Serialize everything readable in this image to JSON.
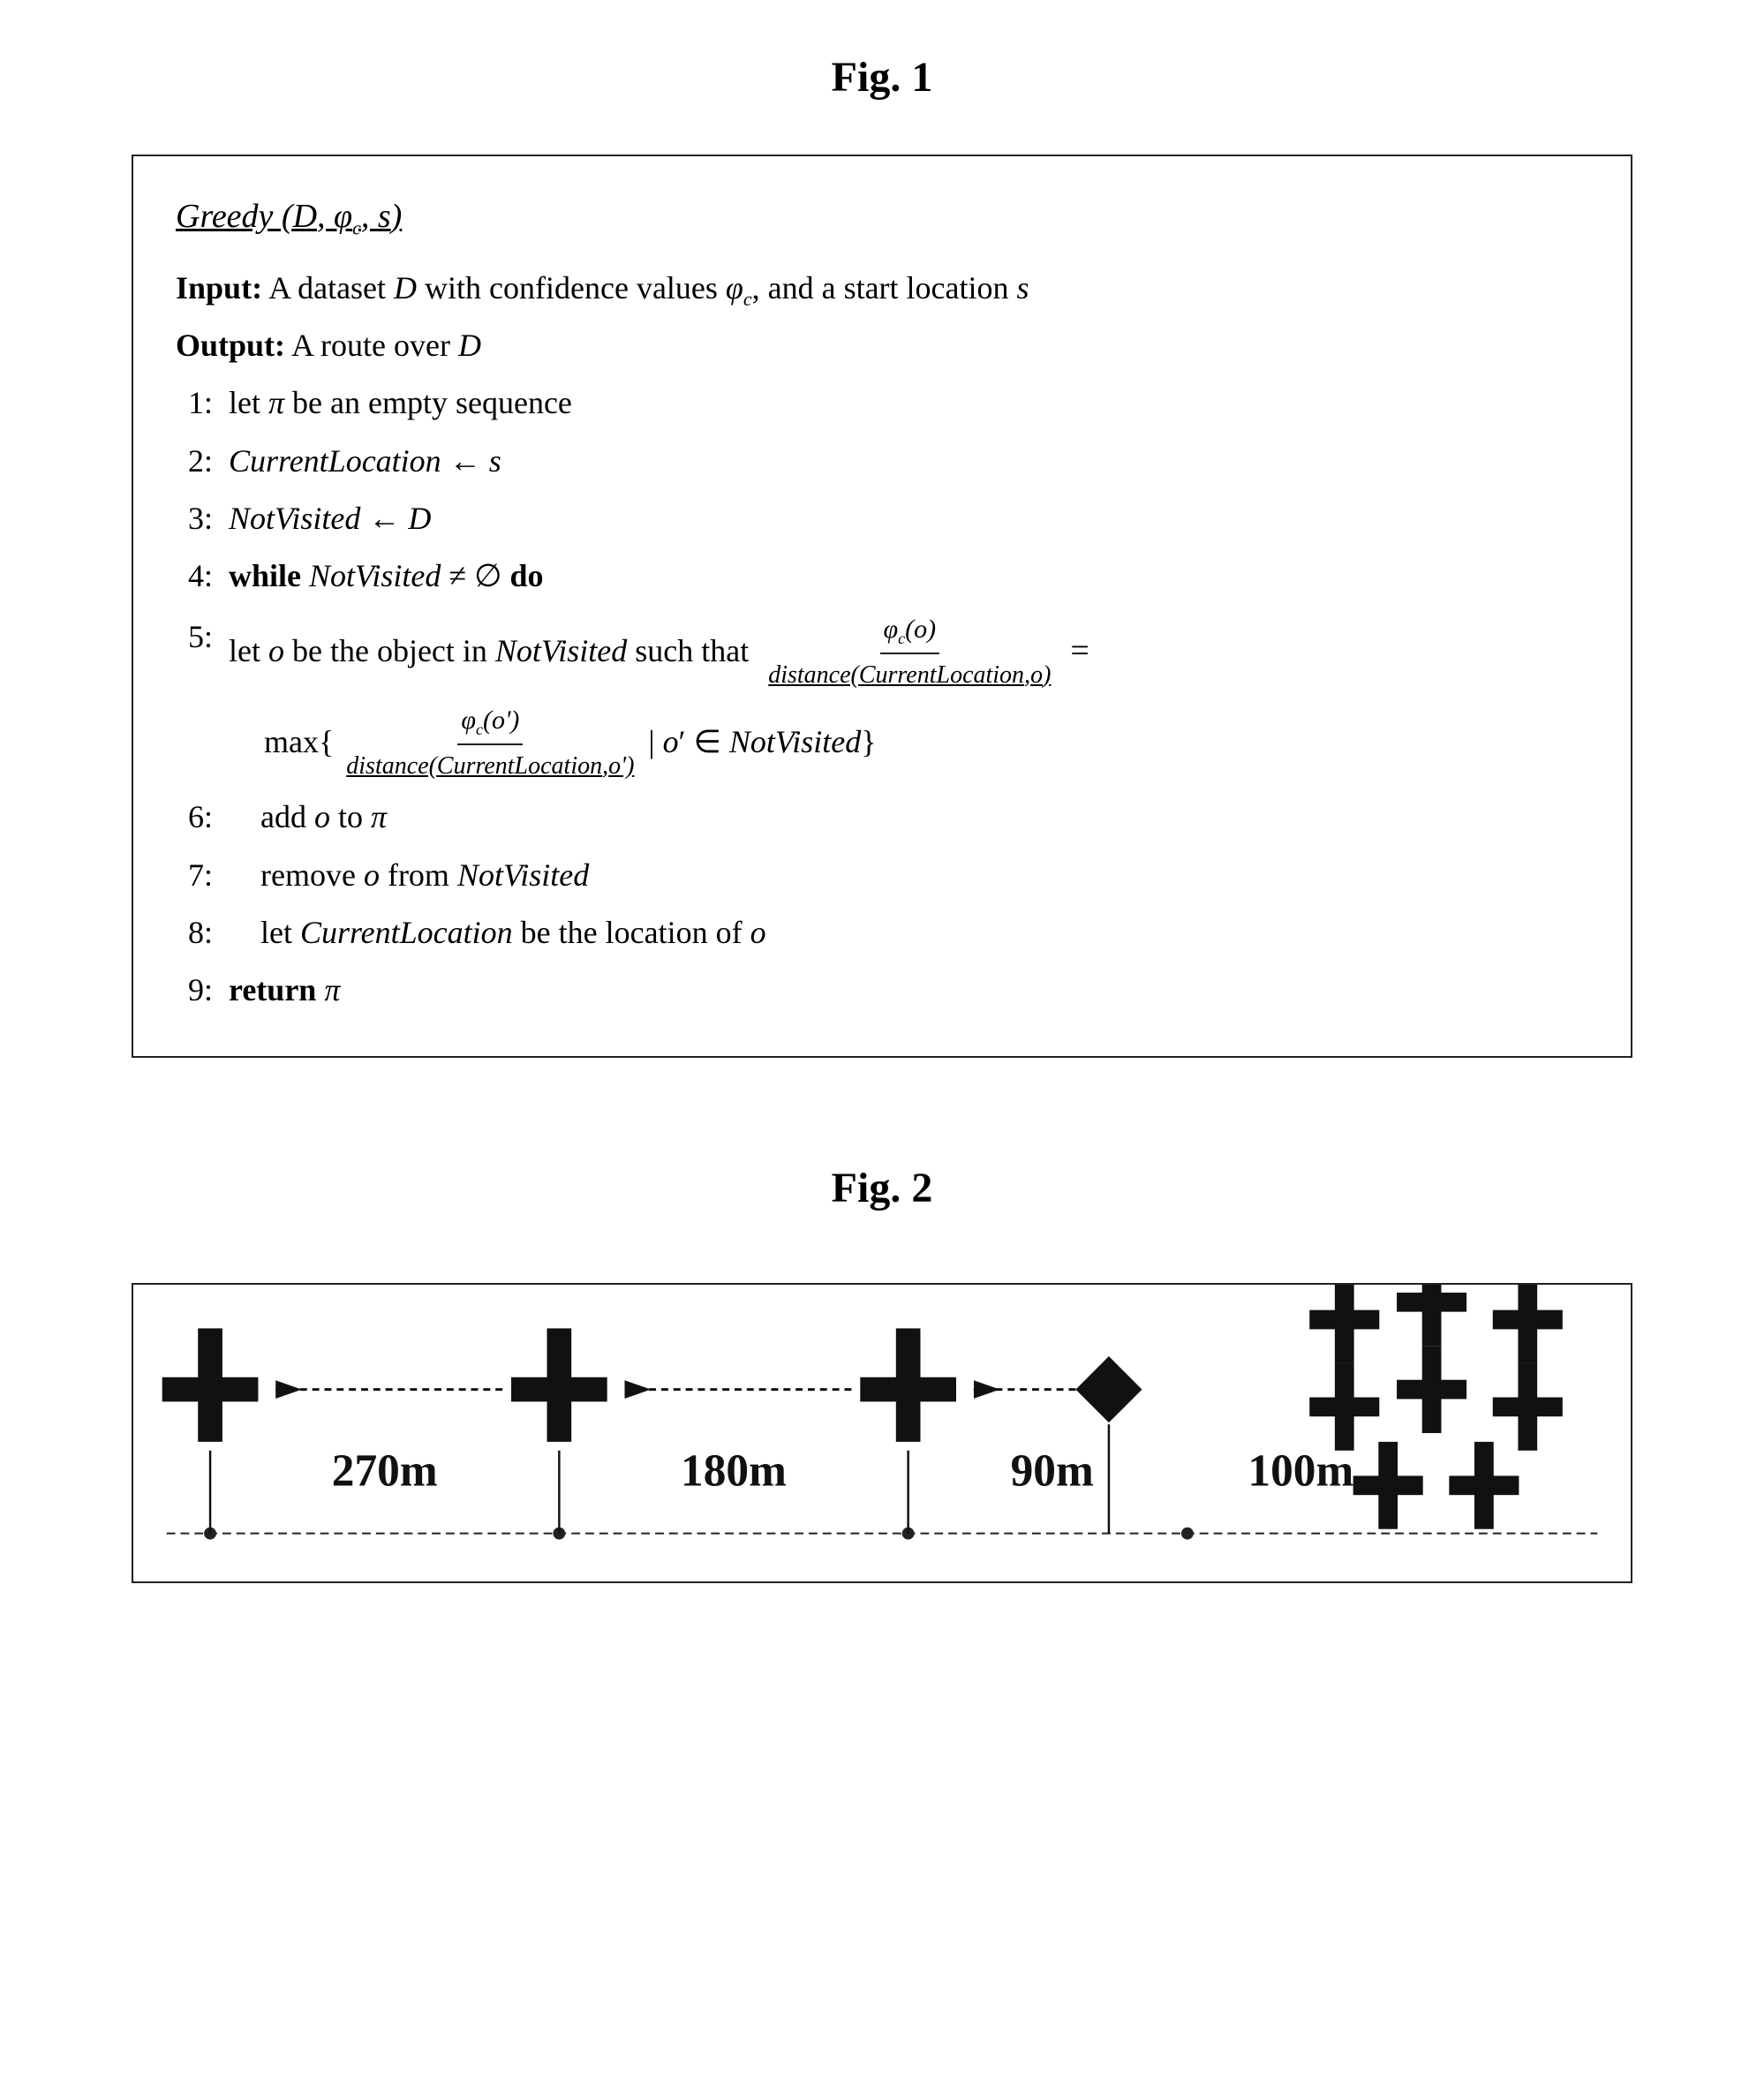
{
  "fig1": {
    "title": "Fig. 1",
    "algorithm": {
      "signature": "Greedy (D, φ_c, s)",
      "input_label": "Input:",
      "input_text": " A dataset D with confidence values φ_c, and a start location s",
      "output_label": "Output:",
      "output_text": " A route over D",
      "lines": [
        {
          "num": "1:",
          "text": "let π be an empty sequence"
        },
        {
          "num": "2:",
          "text": "CurrentLocation ← s"
        },
        {
          "num": "3:",
          "text": "NotVisited ← D"
        },
        {
          "num": "4:",
          "bold_start": "while",
          "text": " NotVisited ≠ ∅ ",
          "bold_end": "do"
        },
        {
          "num": "5:",
          "complex": true
        },
        {
          "num": "6:",
          "text": "add o to π",
          "indent": true
        },
        {
          "num": "7:",
          "text": "remove o from NotVisited",
          "indent": true
        },
        {
          "num": "8:",
          "text": "let CurrentLocation be the location of o",
          "indent": true
        },
        {
          "num": "9:",
          "bold": "return",
          "text": " π"
        }
      ]
    }
  },
  "fig2": {
    "title": "Fig. 2",
    "distances": [
      "270m",
      "180m",
      "90m",
      "100m"
    ]
  }
}
